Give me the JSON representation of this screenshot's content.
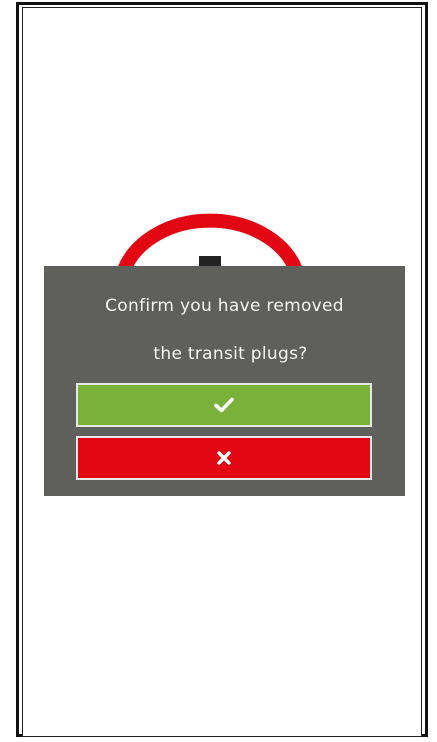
{
  "dialog": {
    "question_line1": "Confirm you have removed",
    "question_line2": "the transit plugs?",
    "confirm_icon": "checkmark-icon",
    "cancel_icon": "close-icon"
  },
  "colors": {
    "dialog_background": "#5f605b",
    "confirm_button": "#79b13a",
    "cancel_button": "#e30613",
    "background_arc": "#e30613"
  }
}
